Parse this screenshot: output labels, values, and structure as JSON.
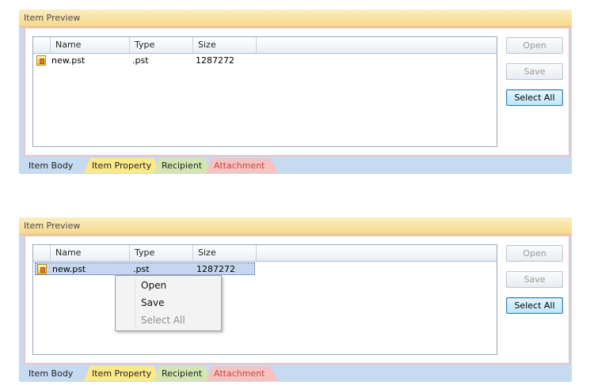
{
  "panels": [
    {
      "title": "Item Preview",
      "columns": [
        "",
        "Name",
        "Type",
        "Size"
      ],
      "rows": [
        {
          "name": "new.pst",
          "type": ".pst",
          "size": "1287272"
        }
      ],
      "buttons": {
        "open": "Open",
        "save": "Save",
        "select_all": "Select All"
      },
      "tabs": [
        "Item Body",
        "Item Property",
        "Recipient",
        "Attachment"
      ]
    },
    {
      "title": "Item Preview",
      "columns": [
        "",
        "Name",
        "Type",
        "Size"
      ],
      "rows": [
        {
          "name": "new.pst",
          "type": ".pst",
          "size": "1287272"
        }
      ],
      "buttons": {
        "open": "Open",
        "save": "Save",
        "select_all": "Select All"
      },
      "tabs": [
        "Item Body",
        "Item Property",
        "Recipient",
        "Attachment"
      ]
    }
  ],
  "context_menu": {
    "items": [
      "Open",
      "Save",
      "Select All"
    ],
    "disabled": [
      "Select All"
    ]
  },
  "colors": {
    "header_gold": "#f6d98b",
    "panel_blue": "#c6daf2",
    "selection": "#c5d6ee",
    "button_focus": "#3c7fb1"
  }
}
